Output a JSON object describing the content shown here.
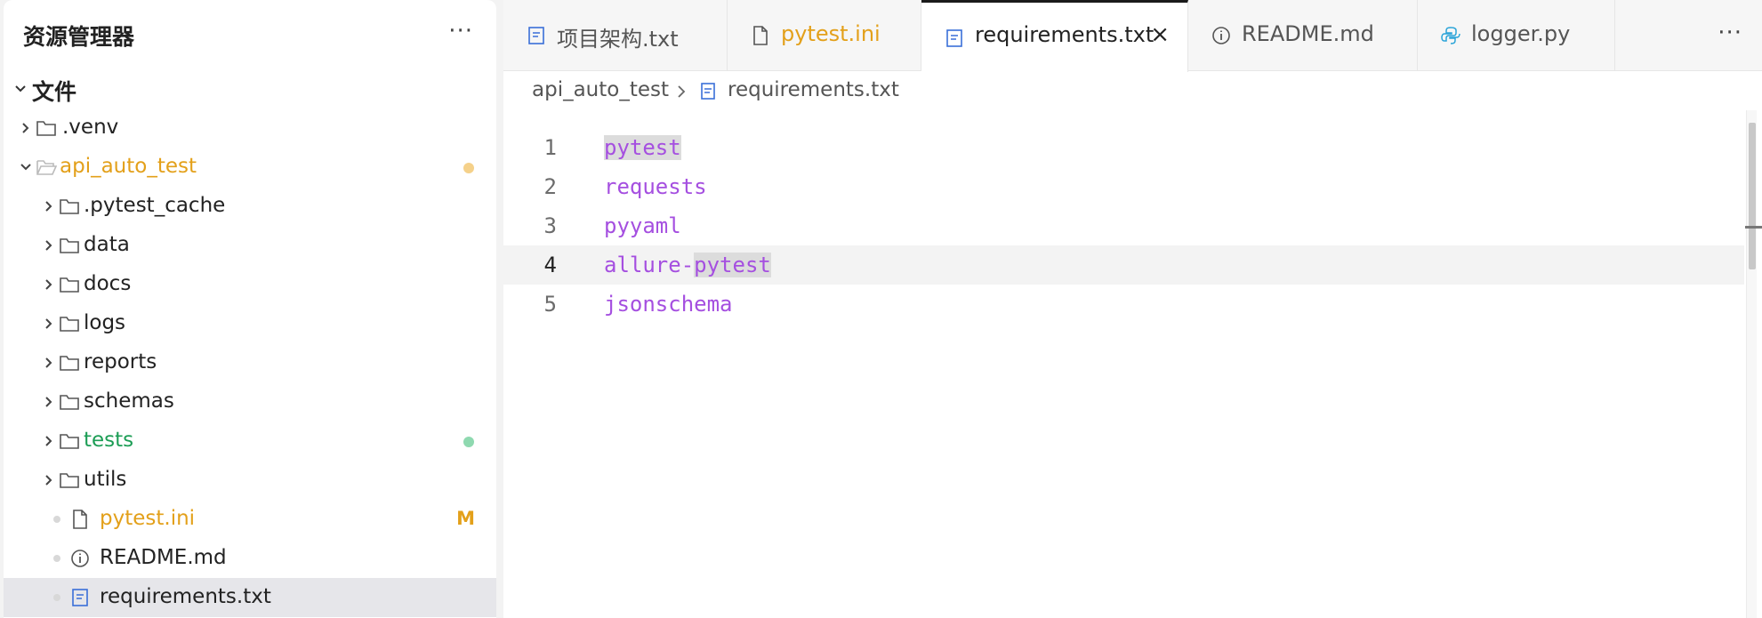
{
  "sidebar": {
    "title": "资源管理器",
    "more": "···",
    "section_label": "文件",
    "items": [
      {
        "label": ".venv"
      },
      {
        "label": "api_auto_test"
      },
      {
        "label": ".pytest_cache"
      },
      {
        "label": "data"
      },
      {
        "label": "docs"
      },
      {
        "label": "logs"
      },
      {
        "label": "reports"
      },
      {
        "label": "schemas"
      },
      {
        "label": "tests"
      },
      {
        "label": "utils"
      },
      {
        "label": "pytest.ini",
        "badge": "M"
      },
      {
        "label": "README.md"
      },
      {
        "label": "requirements.txt"
      }
    ]
  },
  "tabs": [
    {
      "label": "项目架构.txt"
    },
    {
      "label": "pytest.ini"
    },
    {
      "label": "requirements.txt",
      "close": "×"
    },
    {
      "label": "README.md"
    },
    {
      "label": "logger.py"
    }
  ],
  "tab_more": "···",
  "breadcrumb": {
    "folder": "api_auto_test",
    "file": "requirements.txt"
  },
  "code": {
    "lines": [
      {
        "num": "1",
        "text": "pytest"
      },
      {
        "num": "2",
        "text": "requests"
      },
      {
        "num": "3",
        "text": "pyyaml"
      },
      {
        "num": "4",
        "text_a": "allure-",
        "text_b": "pytest"
      },
      {
        "num": "5",
        "text": "jsonschema"
      }
    ]
  },
  "colors": {
    "modified_folder": "#e3a01a",
    "untracked_folder": "#1c9d55",
    "code_text": "#a54fe0"
  }
}
